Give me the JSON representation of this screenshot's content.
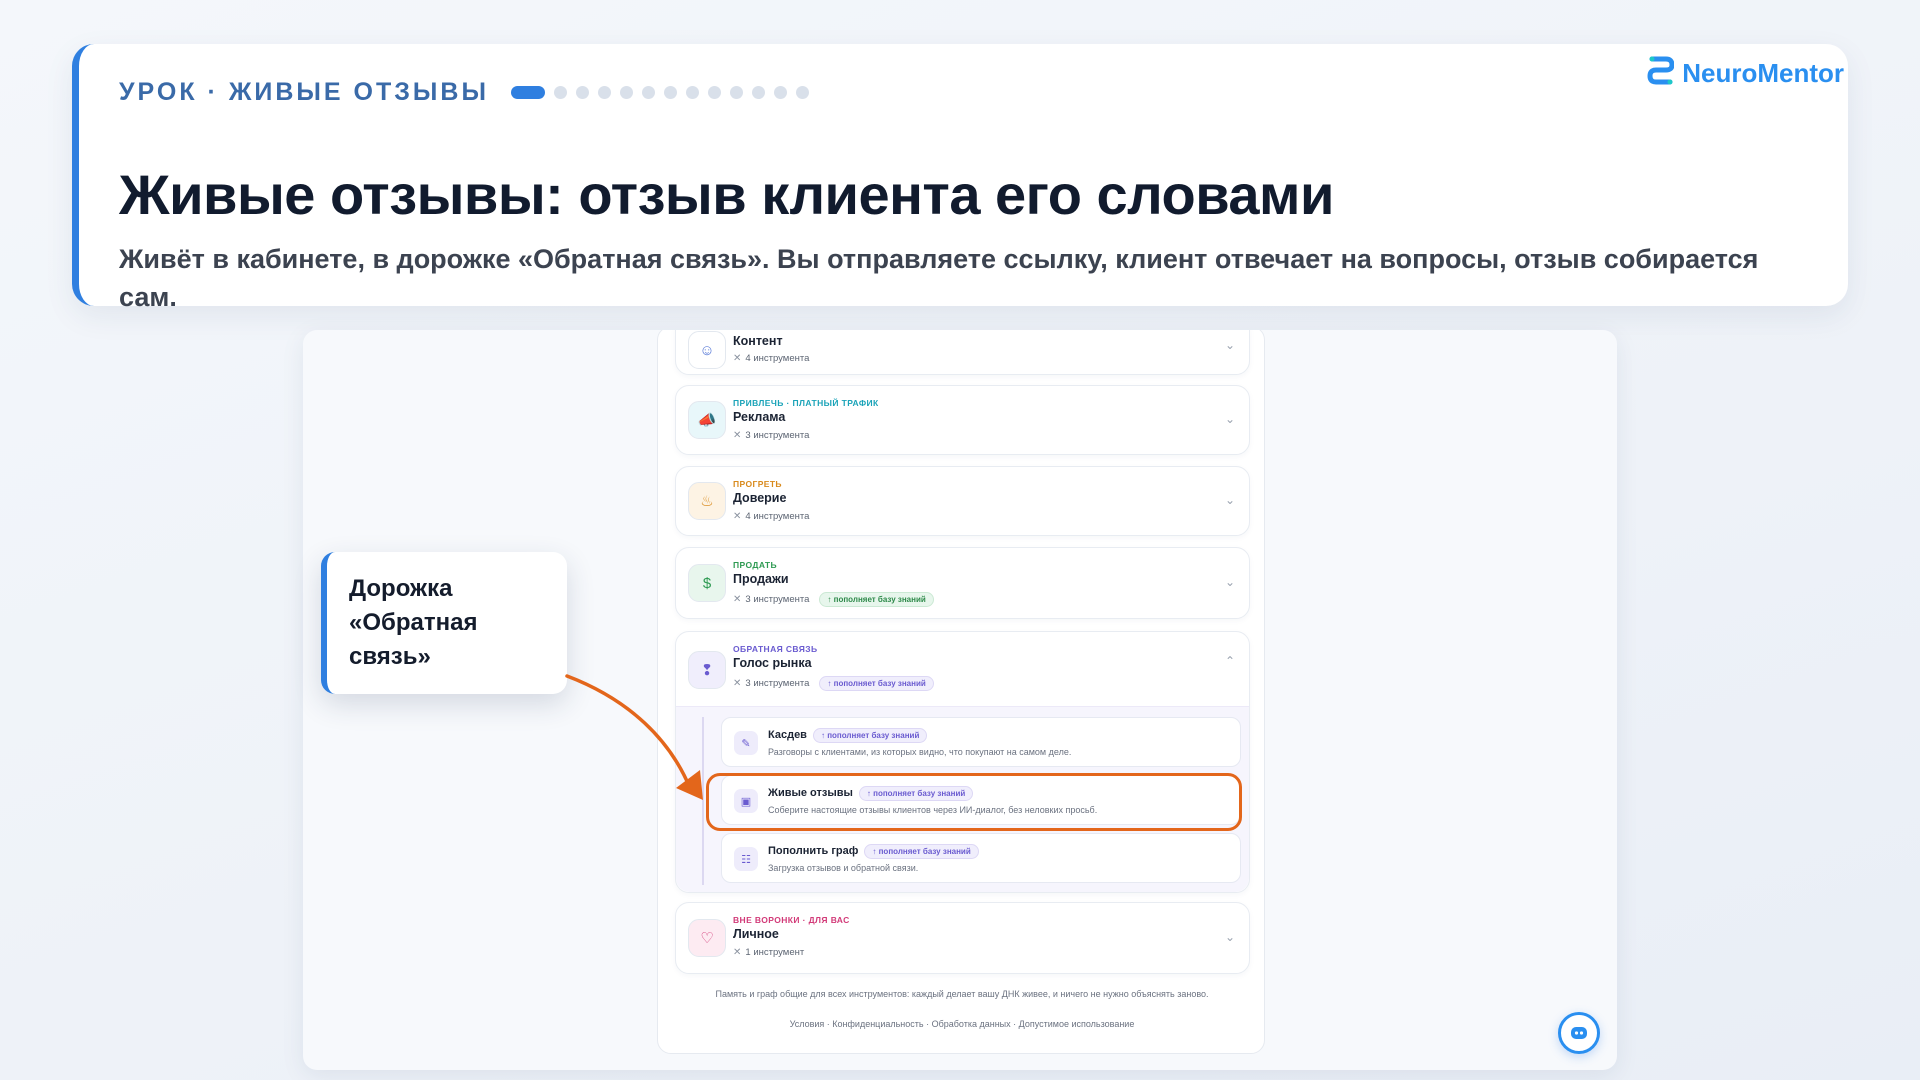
{
  "lesson": {
    "eyebrow": "УРОК · ЖИВЫЕ ОТЗЫВЫ",
    "progress": {
      "current": 1,
      "total": 13
    },
    "title": "Живые отзывы: отзыв клиента его словами",
    "subtitle": "Живёт в кабинете, в дорожке «Обратная связь». Вы отправляете ссылку, клиент отвечает на вопросы, отзыв собирается сам."
  },
  "brand": {
    "name": "NeuroMentor",
    "color": "#2a8ff0"
  },
  "callout": {
    "text": "Дорожка «Обратная связь»"
  },
  "tracks": [
    {
      "tag": "",
      "name": "Контент",
      "count": "4 инструмента",
      "icon": "users-icon",
      "color": "#5a7bd8"
    },
    {
      "tag": "ПРИВЛЕЧЬ · ПЛАТНЫЙ ТРАФИК",
      "name": "Реклама",
      "count": "3 инструмента",
      "icon": "megaphone-icon",
      "color": "#1aa3b8"
    },
    {
      "tag": "ПРОГРЕТЬ",
      "name": "Доверие",
      "count": "4 инструмента",
      "icon": "flame-icon",
      "color": "#d98a1c"
    },
    {
      "tag": "ПРОДАТЬ",
      "name": "Продажи",
      "count": "3 инструмента",
      "badge": "пополняет базу знаний",
      "icon": "money-icon",
      "color": "#2e9a52"
    },
    {
      "tag": "ОБРАТНАЯ СВЯЗЬ",
      "name": "Голос рынка",
      "count": "3 инструмента",
      "badge": "пополняет базу знаний",
      "icon": "ear-icon",
      "color": "#6a5bd0"
    },
    {
      "tag": "ВНЕ ВОРОНКИ · ДЛЯ ВАС",
      "name": "Личное",
      "count": "1 инструмент",
      "icon": "heart-icon",
      "color": "#d23a78"
    }
  ],
  "subtools": [
    {
      "name": "Касдев",
      "badge": "пополняет базу знаний",
      "desc": "Разговоры с клиентами, из которых видно, что покупают на самом деле."
    },
    {
      "name": "Живые отзывы",
      "badge": "пополняет базу знаний",
      "desc": "Соберите настоящие отзывы клиентов через ИИ-диалог, без неловких просьб."
    },
    {
      "name": "Пополнить граф",
      "badge": "пополняет базу знаний",
      "desc": "Загрузка отзывов и обратной связи."
    }
  ],
  "footer": {
    "note": "Память и граф общие для всех инструментов: каждый делает вашу ДНК живее, и ничего не нужно объяснять заново.",
    "links": "Условия · Конфиденциальность · Обработка данных · Допустимое использование"
  },
  "colors": {
    "accent": "#2f7fe0",
    "highlight": "#e3661b"
  }
}
